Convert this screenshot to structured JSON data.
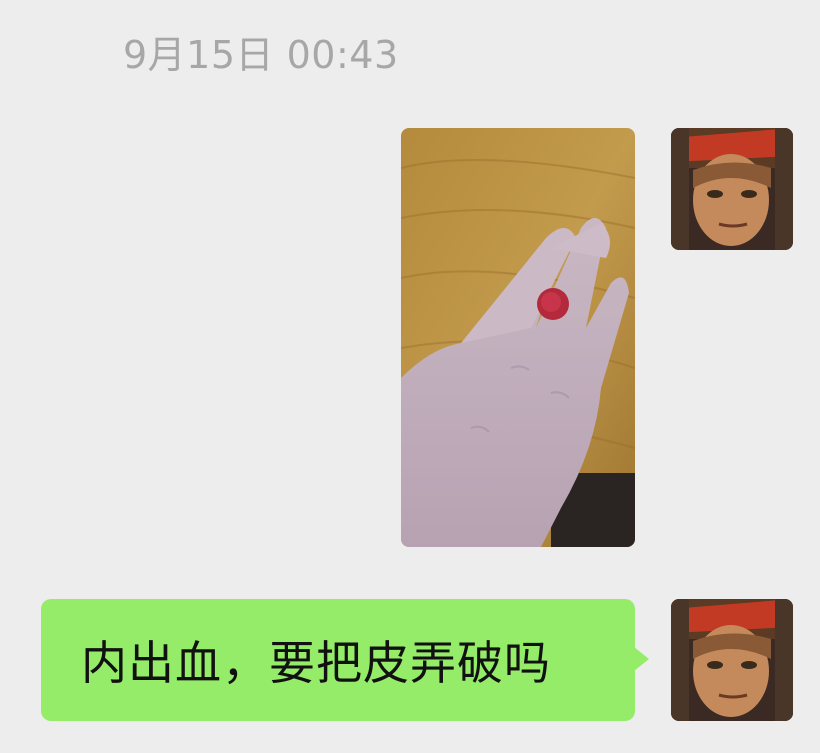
{
  "conversation": {
    "timestamp": "9月15日 00:43",
    "messages": [
      {
        "type": "image",
        "sender": "self",
        "image_description_icon": "hand-photo-icon"
      },
      {
        "type": "text",
        "sender": "self",
        "text": "内出血，要把皮弄破吗"
      }
    ]
  },
  "colors": {
    "background": "#ededed",
    "bubble": "#95ec69",
    "timestamp": "#a7a7a7"
  }
}
